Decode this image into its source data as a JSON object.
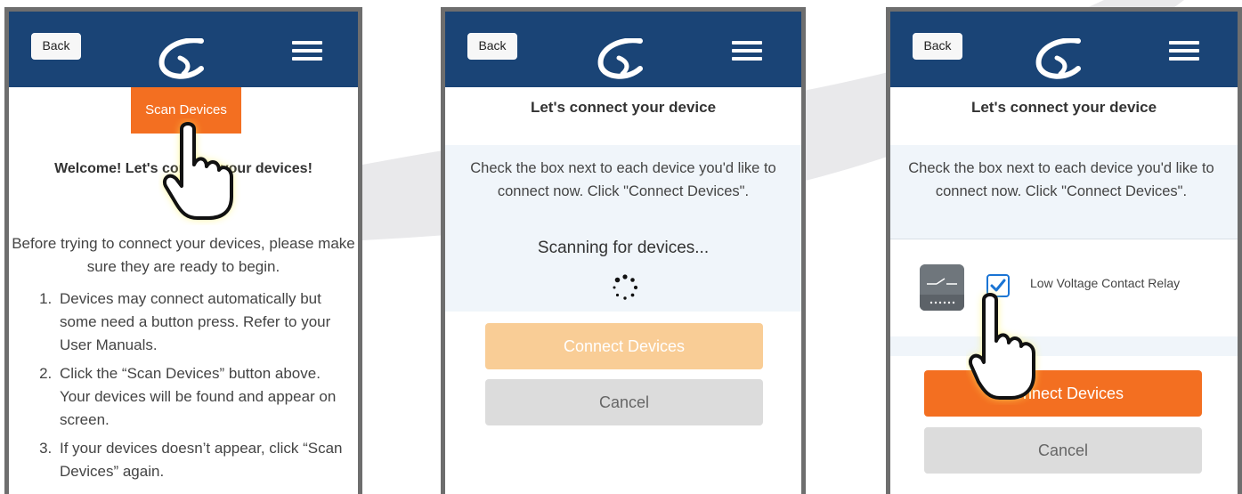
{
  "colors": {
    "header_bg": "#1a4476",
    "accent_orange": "#f36f21",
    "disabled_orange": "#f9cd96",
    "cancel_gray": "#dcdcdc",
    "panel_bg": "#f0f5fa"
  },
  "icons": [
    "app-logo",
    "hamburger-menu-icon",
    "pointing-hand-icon",
    "loading-spinner-icon",
    "relay-device-icon",
    "checkmark-icon"
  ],
  "screen1": {
    "back_label": "Back",
    "scan_label": "Scan Devices",
    "welcome": "Welcome! Let's connect your devices!",
    "intro": "Before trying to connect your devices, please make sure they are ready to begin.",
    "steps": [
      "Devices may connect automatically but some need a button press. Refer to your User Manuals.",
      "Click the “Scan Devices” button above. Your devices will be found and appear on screen.",
      "If your devices doesn’t appear, click “Scan Devices” again."
    ]
  },
  "screen2": {
    "back_label": "Back",
    "title": "Let's connect your device",
    "instructions": "Check the box next to each device you'd like to connect now. Click \"Connect Devices\".",
    "scanning": "Scanning for devices...",
    "connect_label": "Connect Devices",
    "connect_enabled": false,
    "cancel_label": "Cancel"
  },
  "screen3": {
    "back_label": "Back",
    "title": "Let's connect your device",
    "instructions": "Check the box next to each device you'd like to connect now. Click \"Connect Devices\".",
    "device": {
      "name": "Low Voltage Contact Relay",
      "checked": true
    },
    "connect_label": "Connect Devices",
    "connect_enabled": true,
    "cancel_label": "Cancel"
  }
}
